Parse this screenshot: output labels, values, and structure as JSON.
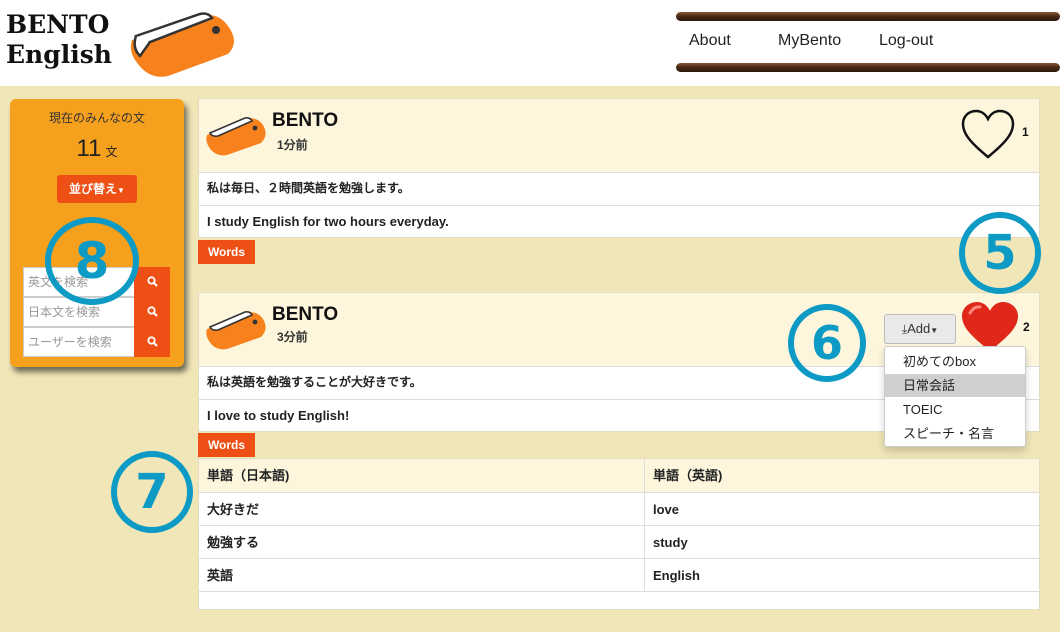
{
  "header": {
    "logo_line1": "BENTO",
    "logo_line2": "English",
    "nav": [
      "About",
      "MyBento",
      "Log-out"
    ]
  },
  "sidebar": {
    "title": "現在のみんなの文",
    "count": "11",
    "count_unit": "文",
    "sort_label": "並び替え",
    "search_placeholders": [
      "英文を検索",
      "日本文を検索",
      "ユーザーを検索"
    ]
  },
  "posts": [
    {
      "author": "BENTO",
      "time": "1分前",
      "japanese": "私は毎日、２時間英語を勉強します。",
      "english": "I study English for two hours everyday.",
      "likes": "1",
      "words_label": "Words"
    },
    {
      "author": "BENTO",
      "time": "3分前",
      "japanese": "私は英語を勉強することが大好きです。",
      "english": "I love to study English!",
      "likes": "2",
      "words_label": "Words"
    }
  ],
  "add_menu": {
    "label": "Add",
    "items": [
      "初めてのbox",
      "日常会話",
      "TOEIC",
      "スピーチ・名言"
    ],
    "highlighted": "日常会話"
  },
  "words_table": {
    "headers": [
      "単語（日本語)",
      "単語（英語)"
    ],
    "rows": [
      [
        "大好きだ",
        "love"
      ],
      [
        "勉強する",
        "study"
      ],
      [
        "英語",
        "English"
      ]
    ]
  },
  "callouts": [
    "5",
    "6",
    "7",
    "8"
  ],
  "colors": {
    "accent": "#ee4f14",
    "sidebar": "#f6a11e",
    "callout": "#0d9ac4",
    "background": "#f0e6b8"
  },
  "icons": [
    "bento-box-icon",
    "heart-outline-icon",
    "heart-filled-icon",
    "search-icon",
    "download-icon",
    "caret-down-icon"
  ]
}
